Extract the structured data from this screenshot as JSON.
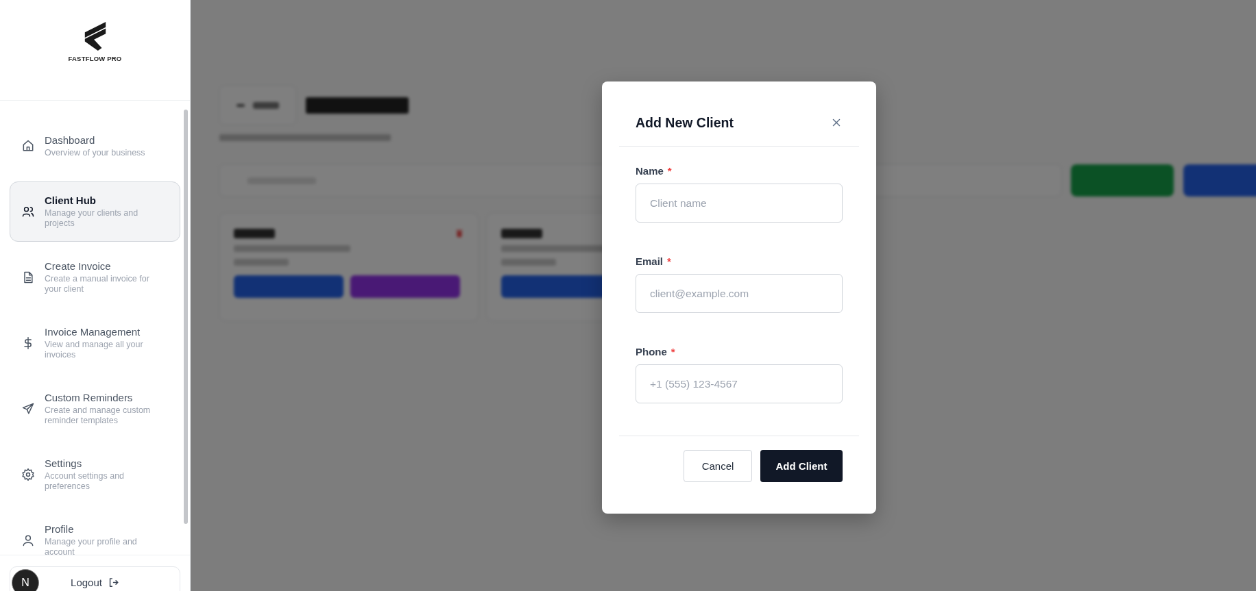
{
  "brand": {
    "name": "FASTFLOW PRO"
  },
  "nav": [
    {
      "title": "Dashboard",
      "desc": "Overview of your business",
      "selected": false
    },
    {
      "title": "Client Hub",
      "desc": "Manage your clients and projects",
      "selected": true
    },
    {
      "title": "Create Invoice",
      "desc": "Create a manual invoice for your client",
      "selected": false
    },
    {
      "title": "Invoice Management",
      "desc": "View and manage all your invoices",
      "selected": false
    },
    {
      "title": "Custom Reminders",
      "desc": "Create and manage custom reminder templates",
      "selected": false
    },
    {
      "title": "Settings",
      "desc": "Account settings and preferences",
      "selected": false
    },
    {
      "title": "Profile",
      "desc": "Manage your profile and account",
      "selected": false
    }
  ],
  "user": {
    "initial": "N",
    "logout": "Logout"
  },
  "page": {
    "actions": [
      {
        "kind": "green"
      },
      {
        "kind": "blue"
      }
    ]
  },
  "cards": [
    {
      "buttons": [
        {
          "kind": "blue"
        },
        {
          "kind": "purple"
        }
      ]
    },
    {
      "buttons": [
        {
          "kind": "blue"
        }
      ]
    }
  ],
  "modal": {
    "title": "Add New Client",
    "fields": [
      {
        "label": "Name",
        "required_mark": "*",
        "placeholder": "Client name"
      },
      {
        "label": "Email",
        "required_mark": "*",
        "placeholder": "client@example.com"
      },
      {
        "label": "Phone",
        "required_mark": "*",
        "placeholder": "+1 (555) 123-4567"
      }
    ],
    "cancel": "Cancel",
    "submit": "Add Client"
  }
}
